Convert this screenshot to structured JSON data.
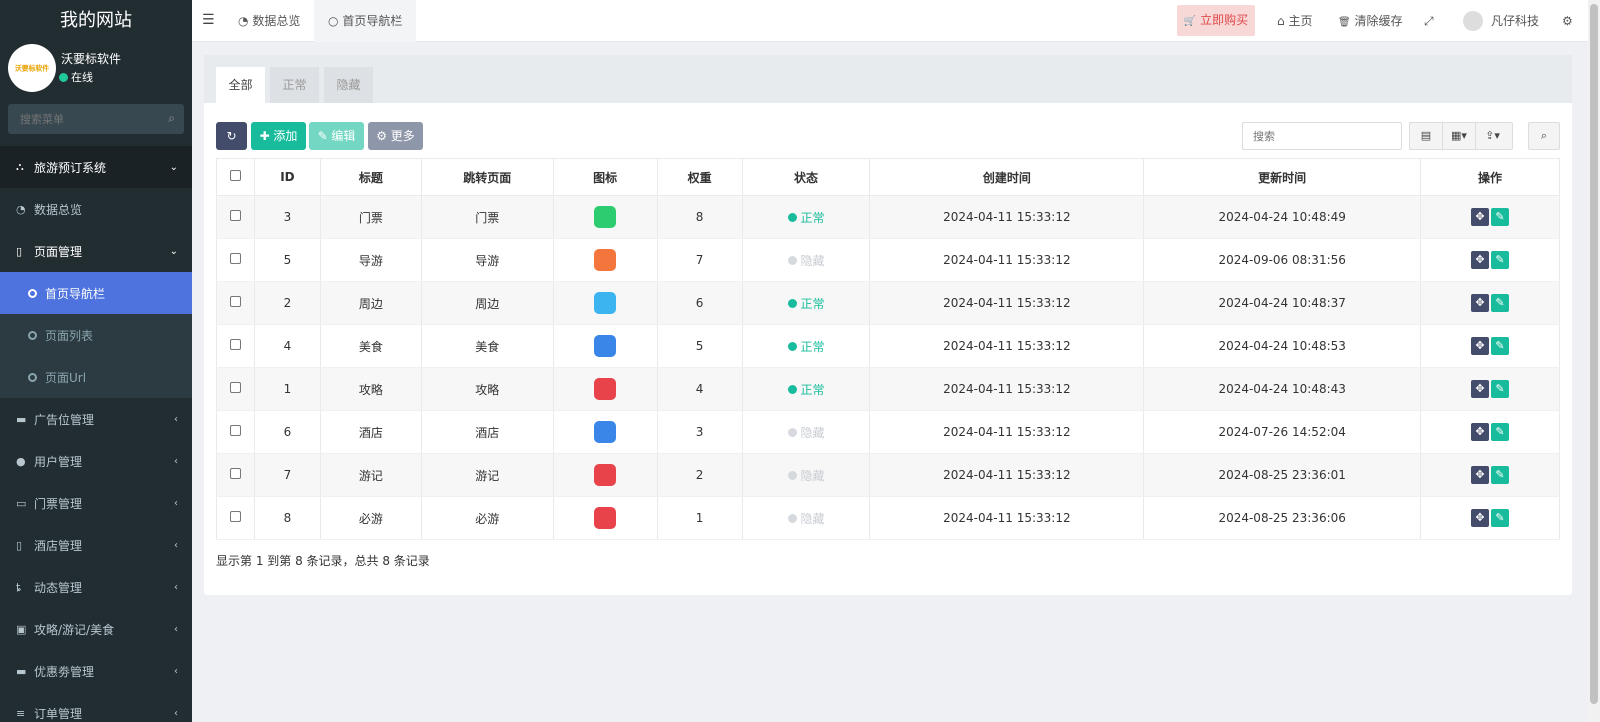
{
  "brand": "我的网站",
  "user": {
    "name": "沃要标软件",
    "status": "在线",
    "logo_text": "沃要标软件"
  },
  "sidebar_search": {
    "placeholder": "搜索菜单"
  },
  "menu": [
    {
      "label": "旅游预订系统",
      "icon": "sitemap-icon",
      "glyph": "⛬",
      "chev": "⌄"
    },
    {
      "label": "数据总览",
      "icon": "dashboard-icon",
      "glyph": "◔"
    },
    {
      "label": "页面管理",
      "icon": "bookmark-icon",
      "glyph": "▯",
      "chev": "⌄"
    },
    {
      "label": "首页导航栏",
      "icon": "circle-icon"
    },
    {
      "label": "页面列表",
      "icon": "circle-icon"
    },
    {
      "label": "页面Url",
      "icon": "circle-icon"
    },
    {
      "label": "广告位管理",
      "icon": "card-icon",
      "glyph": "▬",
      "chev": "‹"
    },
    {
      "label": "用户管理",
      "icon": "user-icon",
      "glyph": "●",
      "chev": "‹"
    },
    {
      "label": "门票管理",
      "icon": "ticket-icon",
      "glyph": "▭",
      "chev": "‹"
    },
    {
      "label": "酒店管理",
      "icon": "building-icon",
      "glyph": "▯",
      "chev": "‹"
    },
    {
      "label": "动态管理",
      "icon": "walk-icon",
      "glyph": "ȶ",
      "chev": "‹"
    },
    {
      "label": "攻略/游记/美食",
      "icon": "image-icon",
      "glyph": "▣",
      "chev": "‹"
    },
    {
      "label": "优惠劵管理",
      "icon": "visa-icon",
      "glyph": "▬",
      "chev": "‹"
    },
    {
      "label": "订单管理",
      "icon": "list-icon",
      "glyph": "≡",
      "chev": "‹"
    }
  ],
  "topbar": {
    "tabs": [
      {
        "label": "数据总览",
        "glyph": "◔"
      },
      {
        "label": "首页导航栏",
        "glyph": "○"
      }
    ],
    "buy_label": "立即购买",
    "buy_glyph": "🛒",
    "home_label": "主页",
    "home_glyph": "⌂",
    "clear_label": "清除缓存",
    "clear_glyph": "🗑",
    "expand_glyph": "⤢",
    "user_name": "凡仔科技",
    "settings_glyph": "⚙"
  },
  "content_tabs": [
    "全部",
    "正常",
    "隐藏"
  ],
  "toolbar": {
    "refresh_glyph": "↻",
    "add_label": "✚ 添加",
    "edit_label": "✎ 编辑",
    "more_label": "⚙ 更多",
    "search_placeholder": "搜索",
    "tool_glyphs": [
      "▤",
      "▦▾",
      "⇪▾"
    ],
    "search_glyph": "⌕"
  },
  "table": {
    "headers": [
      "",
      "ID",
      "标题",
      "跳转页面",
      "图标",
      "权重",
      "状态",
      "创建时间",
      "更新时间",
      "操作"
    ],
    "rows": [
      {
        "id": "3",
        "title": "门票",
        "page": "门票",
        "icon_color": "#2ecc71",
        "icon": "ticket-icon",
        "weight": "8",
        "status": "正常",
        "on": true,
        "created": "2024-04-11 15:33:12",
        "updated": "2024-04-24 10:48:49"
      },
      {
        "id": "5",
        "title": "导游",
        "page": "导游",
        "icon_color": "#f4763d",
        "icon": "guide-icon",
        "weight": "7",
        "status": "隐藏",
        "on": false,
        "created": "2024-04-11 15:33:12",
        "updated": "2024-09-06 08:31:56"
      },
      {
        "id": "2",
        "title": "周边",
        "page": "周边",
        "icon_color": "#3cb4f0",
        "icon": "location-icon",
        "weight": "6",
        "status": "正常",
        "on": true,
        "created": "2024-04-11 15:33:12",
        "updated": "2024-04-24 10:48:37"
      },
      {
        "id": "4",
        "title": "美食",
        "page": "美食",
        "icon_color": "#3a86e8",
        "icon": "food-icon",
        "weight": "5",
        "status": "正常",
        "on": true,
        "created": "2024-04-11 15:33:12",
        "updated": "2024-04-24 10:48:53"
      },
      {
        "id": "1",
        "title": "攻略",
        "page": "攻略",
        "icon_color": "#e8434a",
        "icon": "book-icon",
        "weight": "4",
        "status": "正常",
        "on": true,
        "created": "2024-04-11 15:33:12",
        "updated": "2024-04-24 10:48:43"
      },
      {
        "id": "6",
        "title": "酒店",
        "page": "酒店",
        "icon_color": "#3a86e8",
        "icon": "hotel-icon",
        "weight": "3",
        "status": "隐藏",
        "on": false,
        "created": "2024-04-11 15:33:12",
        "updated": "2024-07-26 14:52:04"
      },
      {
        "id": "7",
        "title": "游记",
        "page": "游记",
        "icon_color": "#e8434a",
        "icon": "star-icon",
        "weight": "2",
        "status": "隐藏",
        "on": false,
        "created": "2024-04-11 15:33:12",
        "updated": "2024-08-25 23:36:01"
      },
      {
        "id": "8",
        "title": "必游",
        "page": "必游",
        "icon_color": "#e8434a",
        "icon": "note-icon",
        "weight": "1",
        "status": "隐藏",
        "on": false,
        "created": "2024-04-11 15:33:12",
        "updated": "2024-08-25 23:36:06"
      }
    ],
    "op_move_glyph": "✥",
    "op_edit_glyph": "✎"
  },
  "footer": "显示第 1 到第 8 条记录，总共 8 条记录",
  "colors": {
    "sidebar_bg": "#222d32",
    "active": "#4e73df",
    "success": "#18bc9c",
    "primary_dark": "#444c6b",
    "buy_bg": "#f8d7d7",
    "buy_text": "#e04848"
  }
}
